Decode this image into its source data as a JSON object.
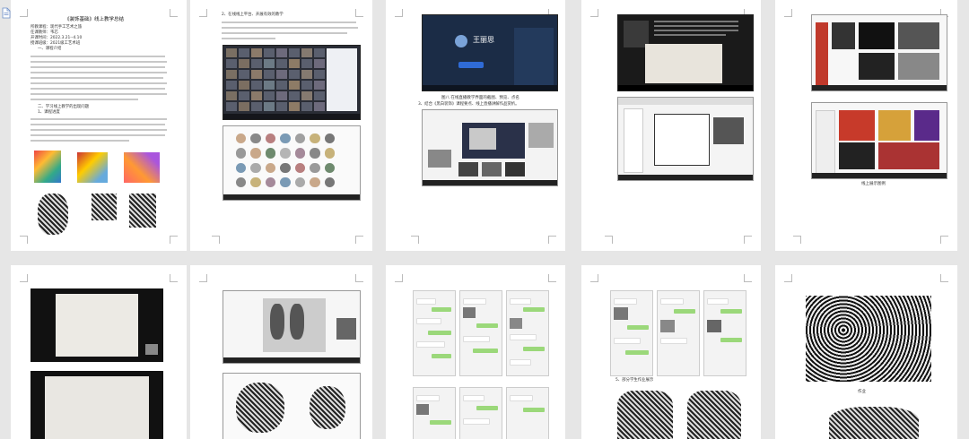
{
  "page1": {
    "title": "《装饰基础》线上教学总结",
    "meta": [
      "所教课程：现代手工艺术之旅",
      "任课教师：韦芯",
      "开课时间：2022.3.21--4.10",
      "授课班级：2021级工艺术班"
    ],
    "section1": "一、课程介绍",
    "section2": "二、学习线上教学的出现问题",
    "section2a": "1、课程进度"
  },
  "page2": {
    "heading": "2、在线线上平台、开展有效的教学"
  },
  "page3": {
    "name": "王丽思",
    "caption1": "图八 在线直播教学界面的截图、预览、点名",
    "heading": "3、结合《黑白装饰》课程要点、线上直播讲解作品赏析。"
  },
  "page5": {
    "caption": "线上展示图例"
  },
  "page8": {
    "heading": "5、部分学生作业展示"
  },
  "page10": {
    "caption": "作业"
  },
  "colors": {
    "page_bg": "#e6e6e6",
    "paper": "#ffffff",
    "chat_green": "#9bd87a"
  },
  "icons": [
    "document-icon"
  ]
}
